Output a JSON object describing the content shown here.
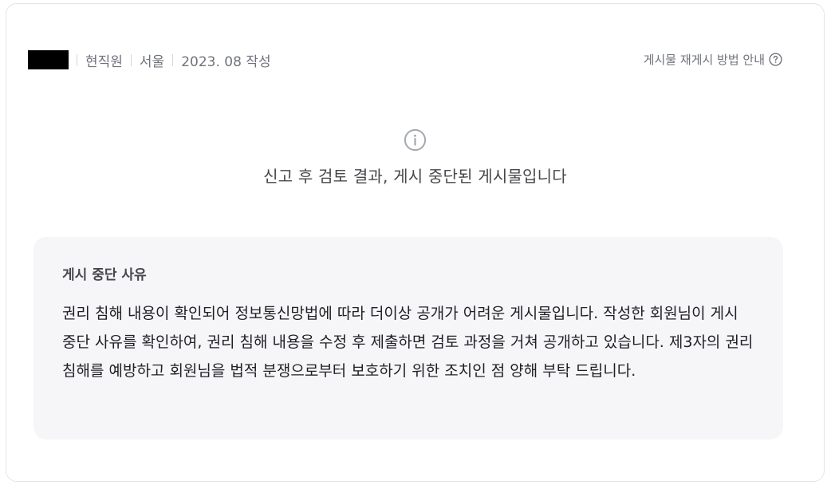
{
  "post_meta": {
    "author_redacted": true,
    "employment_status": "현직원",
    "location": "서울",
    "written_date": "2023. 08 작성"
  },
  "header_action": {
    "repost_guide_label": "게시물 재게시 방법 안내",
    "icon": "question-circle-icon"
  },
  "notice": {
    "icon": "info-circle-icon",
    "message": "신고 후 검토 결과, 게시 중단된 게시물입니다"
  },
  "reason": {
    "title": "게시 중단 사유",
    "body": "권리 침해 내용이 확인되어 정보통신망법에 따라 더이상 공개가 어려운 게시물입니다. 작성한 회원님이 게시 중단 사유를 확인하여, 권리 침해 내용을 수정 후 제출하면 검토 과정을 거쳐 공개하고 있습니다. 제3자의 권리 침해를 예방하고 회원님을 법적 분쟁으로부터 보호하기 위한 조치인 점 양해 부탁 드립니다."
  },
  "colors": {
    "meta_text": "#70737c",
    "reason_background": "#f6f6f8",
    "body_text": "#1f2024"
  }
}
